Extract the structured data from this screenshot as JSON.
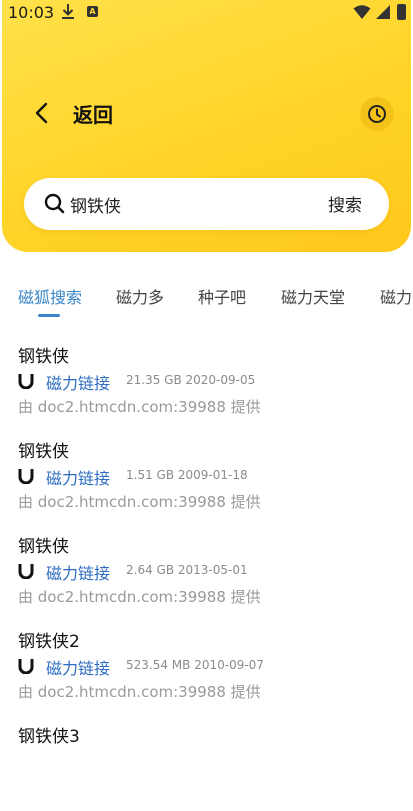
{
  "status_bar": {
    "time": "10:03",
    "notif_letter": "A"
  },
  "header": {
    "back_label": "返回"
  },
  "search": {
    "query": "钢铁侠",
    "submit_label": "搜索"
  },
  "tabs": [
    {
      "label": "磁狐搜索",
      "active": true
    },
    {
      "label": "磁力多",
      "active": false
    },
    {
      "label": "种子吧",
      "active": false
    },
    {
      "label": "磁力天堂",
      "active": false
    },
    {
      "label": "磁力",
      "active": false
    }
  ],
  "results": [
    {
      "title": "钢铁侠",
      "link_label": "磁力链接",
      "meta": "21.35 GB  2020-09-05",
      "source": "由 doc2.htmcdn.com:39988 提供"
    },
    {
      "title": "钢铁侠",
      "link_label": "磁力链接",
      "meta": "1.51 GB  2009-01-18",
      "source": "由 doc2.htmcdn.com:39988 提供"
    },
    {
      "title": "钢铁侠",
      "link_label": "磁力链接",
      "meta": "2.64 GB  2013-05-01",
      "source": "由 doc2.htmcdn.com:39988 提供"
    },
    {
      "title": "钢铁侠2",
      "link_label": "磁力链接",
      "meta": "523.54 MB  2010-09-07",
      "source": "由 doc2.htmcdn.com:39988 提供"
    },
    {
      "title": "钢铁侠3",
      "link_label": "",
      "meta": "",
      "source": ""
    }
  ],
  "colors": {
    "header_yellow": "#ffd428",
    "accent_blue": "#3a86c8",
    "link_blue": "#2d6cc1"
  },
  "icons": {
    "back": "chevron-left-icon",
    "history": "clock-icon",
    "search": "search-icon",
    "magnet": "magnet-icon"
  }
}
